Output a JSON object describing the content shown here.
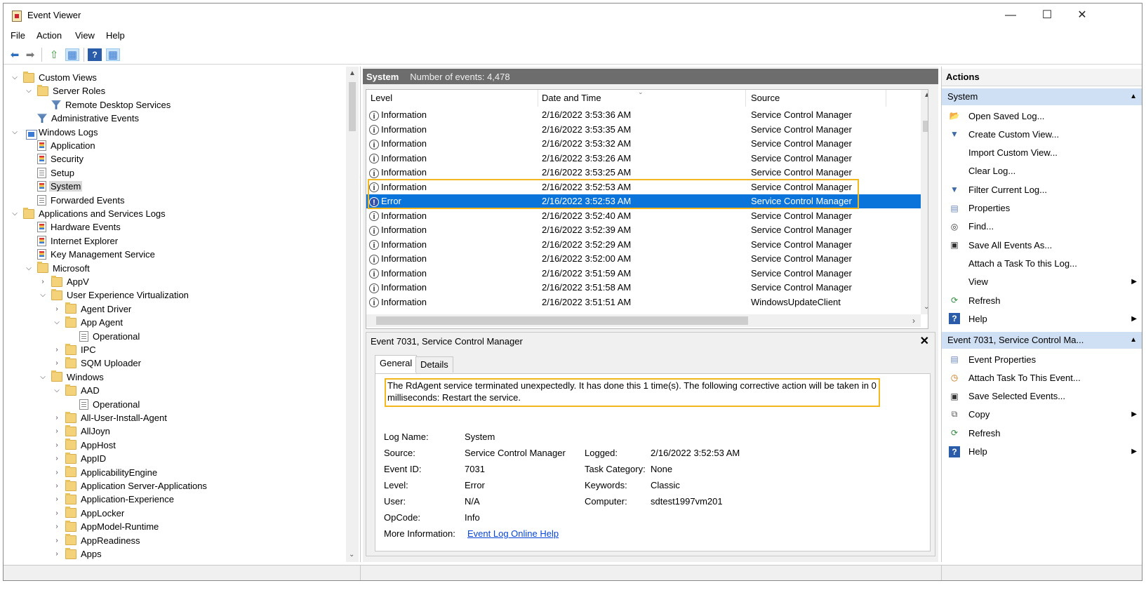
{
  "window": {
    "title": "Event Viewer",
    "minimize": "—",
    "maximize": "☐",
    "close": "✕"
  },
  "menu": [
    "File",
    "Action",
    "View",
    "Help"
  ],
  "tree": [
    {
      "label": "Custom Views",
      "tw": "⌵",
      "icon": "folder"
    },
    {
      "label": "Server Roles",
      "tw": "⌵",
      "icon": "folder"
    },
    {
      "label": "Remote Desktop Services",
      "tw": "",
      "icon": "filter"
    },
    {
      "label": "Administrative Events",
      "tw": "",
      "icon": "filter"
    },
    {
      "label": "Windows Logs",
      "tw": "⌵",
      "icon": "win"
    },
    {
      "label": "Application",
      "tw": "",
      "icon": "elog"
    },
    {
      "label": "Security",
      "tw": "",
      "icon": "elog"
    },
    {
      "label": "Setup",
      "tw": "",
      "icon": "log"
    },
    {
      "label": "System",
      "tw": "",
      "icon": "elog",
      "selected": true
    },
    {
      "label": "Forwarded Events",
      "tw": "",
      "icon": "log"
    },
    {
      "label": "Applications and Services Logs",
      "tw": "⌵",
      "icon": "folder"
    },
    {
      "label": "Hardware Events",
      "tw": "",
      "icon": "elog"
    },
    {
      "label": "Internet Explorer",
      "tw": "",
      "icon": "elog"
    },
    {
      "label": "Key Management Service",
      "tw": "",
      "icon": "elog"
    },
    {
      "label": "Microsoft",
      "tw": "⌵",
      "icon": "folder"
    },
    {
      "label": "AppV",
      "tw": "›",
      "icon": "folder"
    },
    {
      "label": "User Experience Virtualization",
      "tw": "⌵",
      "icon": "folder"
    },
    {
      "label": "Agent Driver",
      "tw": "›",
      "icon": "folder"
    },
    {
      "label": "App Agent",
      "tw": "⌵",
      "icon": "folder"
    },
    {
      "label": "Operational",
      "tw": "",
      "icon": "log"
    },
    {
      "label": "IPC",
      "tw": "›",
      "icon": "folder"
    },
    {
      "label": "SQM Uploader",
      "tw": "›",
      "icon": "folder"
    },
    {
      "label": "Windows",
      "tw": "⌵",
      "icon": "folder"
    },
    {
      "label": "AAD",
      "tw": "⌵",
      "icon": "folder"
    },
    {
      "label": "Operational",
      "tw": "",
      "icon": "log"
    },
    {
      "label": "All-User-Install-Agent",
      "tw": "›",
      "icon": "folder"
    },
    {
      "label": "AllJoyn",
      "tw": "›",
      "icon": "folder"
    },
    {
      "label": "AppHost",
      "tw": "›",
      "icon": "folder"
    },
    {
      "label": "AppID",
      "tw": "›",
      "icon": "folder"
    },
    {
      "label": "ApplicabilityEngine",
      "tw": "›",
      "icon": "folder"
    },
    {
      "label": "Application Server-Applications",
      "tw": "›",
      "icon": "folder"
    },
    {
      "label": "Application-Experience",
      "tw": "›",
      "icon": "folder"
    },
    {
      "label": "AppLocker",
      "tw": "›",
      "icon": "folder"
    },
    {
      "label": "AppModel-Runtime",
      "tw": "›",
      "icon": "folder"
    },
    {
      "label": "AppReadiness",
      "tw": "›",
      "icon": "folder"
    },
    {
      "label": "Apps",
      "tw": "›",
      "icon": "folder"
    }
  ],
  "center": {
    "log_name": "System",
    "count_text": "Number of events: 4,478"
  },
  "columns": {
    "level": "Level",
    "datetime": "Date and Time",
    "source": "Source"
  },
  "events": [
    {
      "level": "Information",
      "datetime": "2/16/2022 3:53:36 AM",
      "source": "Service Control Manager"
    },
    {
      "level": "Information",
      "datetime": "2/16/2022 3:53:35 AM",
      "source": "Service Control Manager"
    },
    {
      "level": "Information",
      "datetime": "2/16/2022 3:53:32 AM",
      "source": "Service Control Manager"
    },
    {
      "level": "Information",
      "datetime": "2/16/2022 3:53:26 AM",
      "source": "Service Control Manager"
    },
    {
      "level": "Information",
      "datetime": "2/16/2022 3:53:25 AM",
      "source": "Service Control Manager"
    },
    {
      "level": "Information",
      "datetime": "2/16/2022 3:52:53 AM",
      "source": "Service Control Manager"
    },
    {
      "level": "Error",
      "datetime": "2/16/2022 3:52:53 AM",
      "source": "Service Control Manager",
      "selected": true
    },
    {
      "level": "Information",
      "datetime": "2/16/2022 3:52:40 AM",
      "source": "Service Control Manager"
    },
    {
      "level": "Information",
      "datetime": "2/16/2022 3:52:39 AM",
      "source": "Service Control Manager"
    },
    {
      "level": "Information",
      "datetime": "2/16/2022 3:52:29 AM",
      "source": "Service Control Manager"
    },
    {
      "level": "Information",
      "datetime": "2/16/2022 3:52:00 AM",
      "source": "Service Control Manager"
    },
    {
      "level": "Information",
      "datetime": "2/16/2022 3:51:59 AM",
      "source": "Service Control Manager"
    },
    {
      "level": "Information",
      "datetime": "2/16/2022 3:51:58 AM",
      "source": "Service Control Manager"
    },
    {
      "level": "Information",
      "datetime": "2/16/2022 3:51:51 AM",
      "source": "WindowsUpdateClient"
    }
  ],
  "detail": {
    "title": "Event 7031, Service Control Manager",
    "close": "✕",
    "tabs": [
      "General",
      "Details"
    ],
    "message_line1": "The RdAgent service terminated unexpectedly.  It has done this 1 time(s).  The following corrective action will be taken in 0",
    "message_line2": "milliseconds: Restart the service.",
    "labels": {
      "log_name": "Log Name:",
      "source": "Source:",
      "event_id": "Event ID:",
      "level": "Level:",
      "user": "User:",
      "opcode": "OpCode:",
      "more_info": "More Information:",
      "logged": "Logged:",
      "task_category": "Task Category:",
      "keywords": "Keywords:",
      "computer": "Computer:"
    },
    "values": {
      "log_name": "System",
      "source": "Service Control Manager",
      "event_id": "7031",
      "level": "Error",
      "user": "N/A",
      "opcode": "Info",
      "more_info_link": "Event Log Online Help",
      "logged": "2/16/2022 3:52:53 AM",
      "task_category": "None",
      "keywords": "Classic",
      "computer": "sdtest1997vm201"
    }
  },
  "actions": {
    "header": "Actions",
    "section1": "System",
    "items1": [
      {
        "label": "Open Saved Log...",
        "icon": "open-folder-icon",
        "glyph": "📂"
      },
      {
        "label": "Create Custom View...",
        "icon": "filter-icon",
        "glyph": "▼"
      },
      {
        "label": "Import Custom View...",
        "icon": "",
        "glyph": ""
      },
      {
        "label": "Clear Log...",
        "icon": "",
        "glyph": ""
      },
      {
        "label": "Filter Current Log...",
        "icon": "filter-icon",
        "glyph": "▼"
      },
      {
        "label": "Properties",
        "icon": "properties-icon",
        "glyph": "▤"
      },
      {
        "label": "Find...",
        "icon": "binoculars-icon",
        "glyph": "◎"
      },
      {
        "label": "Save All Events As...",
        "icon": "save-icon",
        "glyph": "▣"
      },
      {
        "label": "Attach a Task To this Log...",
        "icon": "",
        "glyph": ""
      },
      {
        "label": "View",
        "icon": "",
        "glyph": "",
        "submenu": true
      },
      {
        "label": "Refresh",
        "icon": "refresh-icon",
        "glyph": "⟳"
      },
      {
        "label": "Help",
        "icon": "help-icon",
        "glyph": "?",
        "submenu": true
      }
    ],
    "section2": "Event 7031, Service Control Ma...",
    "items2": [
      {
        "label": "Event Properties",
        "icon": "properties-icon",
        "glyph": "▤"
      },
      {
        "label": "Attach Task To This Event...",
        "icon": "task-icon",
        "glyph": "◷"
      },
      {
        "label": "Save Selected Events...",
        "icon": "save-icon",
        "glyph": "▣"
      },
      {
        "label": "Copy",
        "icon": "copy-icon",
        "glyph": "⧉",
        "submenu": true
      },
      {
        "label": "Refresh",
        "icon": "refresh-icon",
        "glyph": "⟳"
      },
      {
        "label": "Help",
        "icon": "help-icon",
        "glyph": "?",
        "submenu": true
      }
    ]
  },
  "colors": {
    "selection": "#0a74da",
    "highlight": "#f3b81d",
    "header_dark": "#6d6d6d",
    "section": "#cfe0f4"
  }
}
